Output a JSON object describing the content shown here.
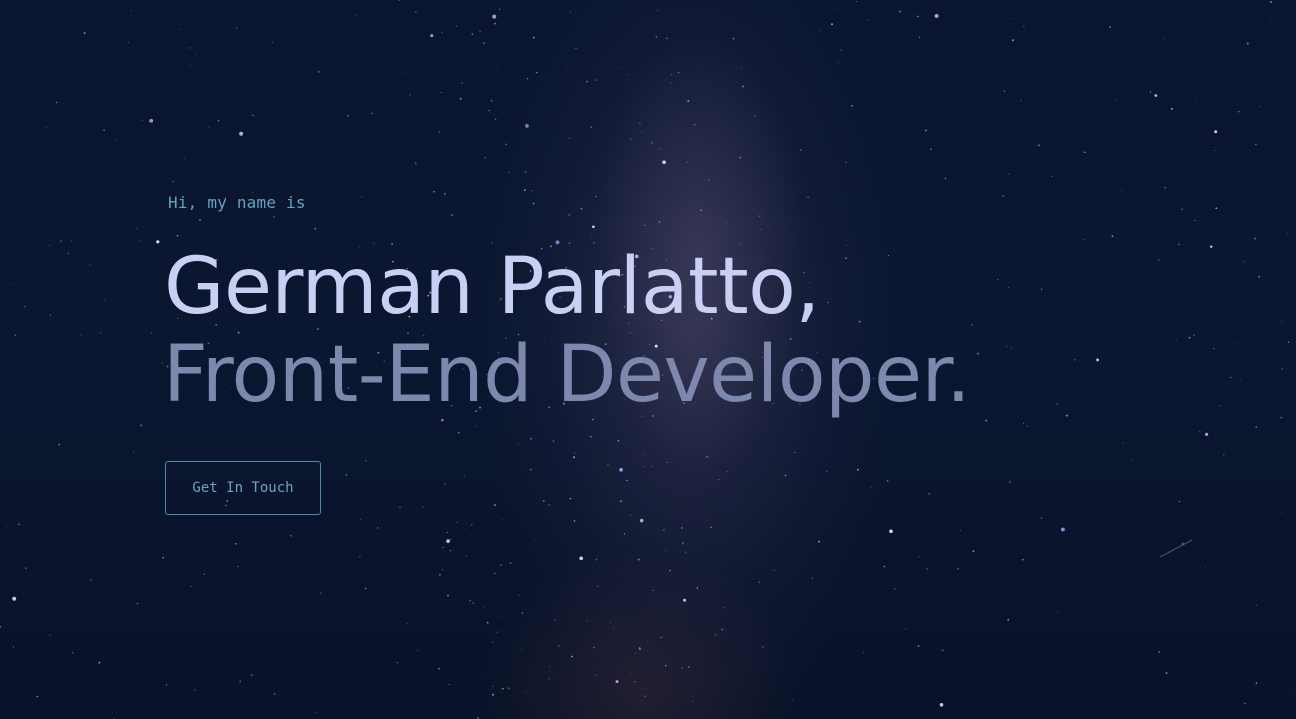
{
  "hero": {
    "intro": "Hi, my name is",
    "name": "German Parlatto,",
    "role": "Front-End Developer.",
    "cta_label": "Get In Touch"
  },
  "colors": {
    "background": "#071126",
    "intro_text": "#62a3bd",
    "name_text": "#c9d0f4",
    "role_text": "#7d88ac",
    "button_border": "#4f8aa6",
    "button_text": "#6aa6c2"
  }
}
